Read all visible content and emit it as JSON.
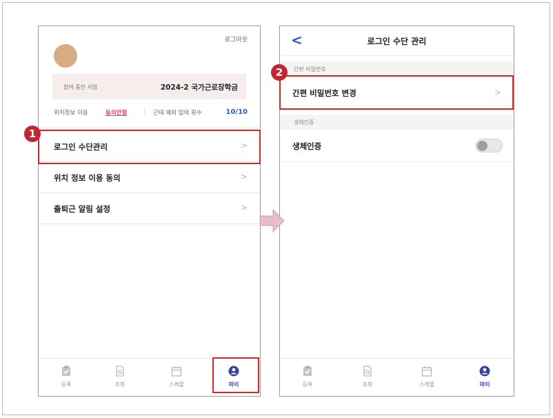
{
  "screen1": {
    "logout": "로그아웃",
    "biz_label": "참여 중인 사업",
    "biz_value": "2024-2 국가근로장학금",
    "location_label": "위치정보 이용",
    "location_link": "동의안함",
    "separator": "|",
    "count_label": "근태 예외 입력 횟수",
    "count_value": "10/10",
    "menu": [
      {
        "label": "로그인 수단관리",
        "chevron": ">"
      },
      {
        "label": "위치 정보 이용 동의",
        "chevron": ">"
      },
      {
        "label": "출퇴근 알림 설정",
        "chevron": ">"
      }
    ]
  },
  "screen2": {
    "back": "<",
    "title": "로그인 수단 관리",
    "section1": "간편 비밀번호",
    "pin_change": "간편 비밀번호 변경",
    "chevron": ">",
    "section2": "생체인증",
    "biometric": "생체인증",
    "biometric_enabled": false
  },
  "nav": [
    {
      "label": "등록",
      "icon": "clipboard-check-icon",
      "active": false
    },
    {
      "label": "조회",
      "icon": "document-search-icon",
      "active": false
    },
    {
      "label": "스케줄",
      "icon": "calendar-icon",
      "active": false
    },
    {
      "label": "마이",
      "icon": "user-circle-icon",
      "active": true
    }
  ],
  "badges": {
    "step1": "1",
    "step2": "2"
  },
  "colors": {
    "highlight": "#d3262a",
    "accent": "#2f56c4",
    "link": "#e0457b",
    "active_nav": "#3b3f9e"
  }
}
